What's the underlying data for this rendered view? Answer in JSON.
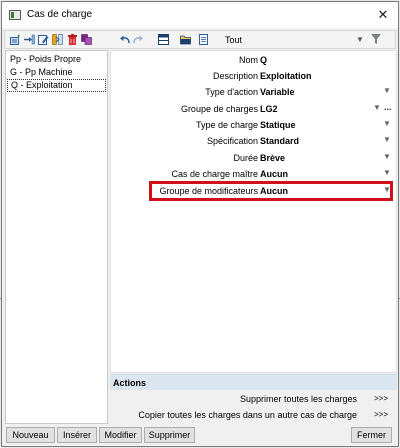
{
  "window": {
    "title": "Cas de charge",
    "close_glyph": "✕"
  },
  "toolbar": {
    "icons": [
      "add-load-case-icon",
      "insert-icon",
      "edit-icon",
      "split-icon",
      "delete-icon",
      "copy-icon",
      "undo-icon",
      "redo-icon",
      "table-icon",
      "folder-icon",
      "document-icon"
    ],
    "filter_value": "Tout",
    "dropdown_glyph": "▼"
  },
  "list": {
    "items": [
      "Pp - Poids Propre",
      "G - Pp Machine",
      "Q - Exploitation"
    ],
    "selected_index": 2
  },
  "properties": [
    {
      "label": "Nom",
      "value": "Q",
      "dropdown": false
    },
    {
      "label": "Description",
      "value": "Exploitation",
      "dropdown": false
    },
    {
      "label": "Type d'action",
      "value": "Variable",
      "dropdown": true
    },
    {
      "label": "Groupe de charges",
      "value": "LG2",
      "dropdown": true,
      "ellipsis": "..."
    },
    {
      "label": "Type de charge",
      "value": "Statique",
      "dropdown": true
    },
    {
      "label": "Spécification",
      "value": "Standard",
      "dropdown": true
    },
    {
      "label": "Durée",
      "value": "Brève",
      "dropdown": true
    },
    {
      "label": "Cas de charge maître",
      "value": "Aucun",
      "dropdown": true
    },
    {
      "label": "Groupe de modificateurs",
      "value": "Aucun",
      "dropdown": true
    }
  ],
  "actions": {
    "header": "Actions",
    "rows": [
      {
        "label": "Supprimer toutes les charges",
        "button": ">>>"
      },
      {
        "label": "Copier toutes les charges dans un autre cas de charge",
        "button": ">>>"
      }
    ]
  },
  "buttons": {
    "new": "Nouveau",
    "insert": "Insérer",
    "modify": "Modifier",
    "delete": "Supprimer",
    "close": "Fermer"
  },
  "colors": {
    "highlight": "#d1111a",
    "actions_header": "#dce6f1",
    "dropdown_arrow": "#666666"
  }
}
